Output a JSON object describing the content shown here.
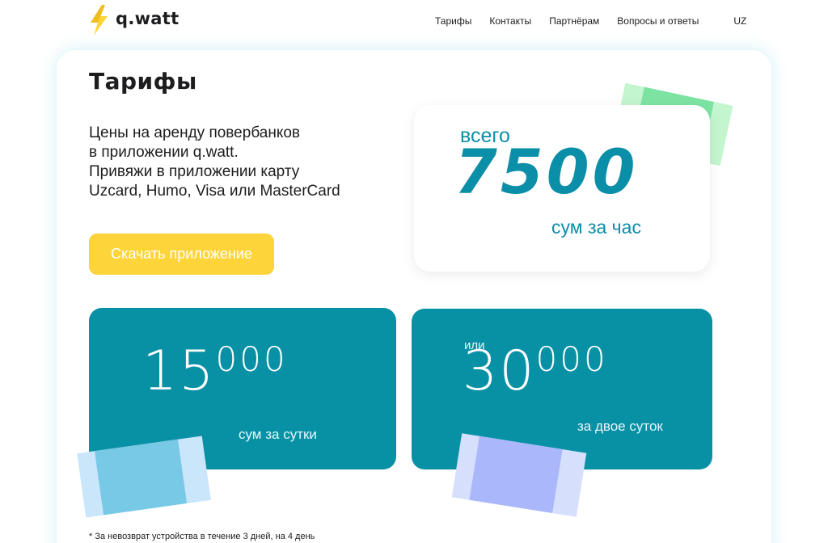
{
  "header": {
    "logo_text": "q.watt",
    "nav": [
      "Тарифы",
      "Контакты",
      "Партнёрам",
      "Вопросы и ответы"
    ],
    "lang": "UZ"
  },
  "hero": {
    "title": "Тарифы",
    "description_lines": [
      "Цены на аренду повербанков",
      "в приложении q.watt.",
      "Привяжи в приложении карту",
      "Uzcard, Humo, Visa или MasterCard"
    ],
    "download_button": "Скачать приложение"
  },
  "hourly": {
    "prefix": "всего",
    "amount": "7500",
    "unit": "сум за час"
  },
  "daily": {
    "amount_main": "15",
    "amount_sup": "000",
    "unit": "сум за сутки"
  },
  "two_days": {
    "prefix": "или",
    "amount_main": "30",
    "amount_sup": "000",
    "unit": "за двое суток"
  },
  "footnote": "* За невозврат устройства в течение 3 дней, на 4 день",
  "colors": {
    "accent_teal": "#0891a5",
    "button_yellow": "#fdd53b",
    "bill_green": "#7de3a3",
    "bill_blue": "#77c9e6",
    "bill_purple": "#aab8fb"
  }
}
